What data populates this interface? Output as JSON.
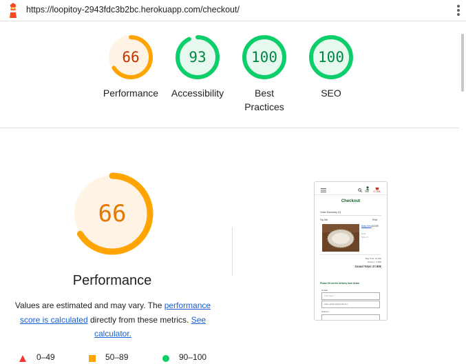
{
  "browser": {
    "url": "https://loopitoy-2943fdc3b2bc.herokuapp.com/checkout/"
  },
  "categories": [
    {
      "label": "Performance",
      "score": "66",
      "rating": "average"
    },
    {
      "label": "Accessibility",
      "score": "93",
      "rating": "pass"
    },
    {
      "label": "Best Practices",
      "label_lines": [
        "Best",
        "Practices"
      ],
      "score": "100",
      "rating": "pass"
    },
    {
      "label": "SEO",
      "score": "100",
      "rating": "pass"
    }
  ],
  "detail": {
    "score": "66",
    "title": "Performance",
    "desc_prefix": "Values are estimated and may vary. The ",
    "desc_link1": "performance score is calculated",
    "desc_middle": " directly from these metrics. ",
    "desc_link2": "See calculator."
  },
  "legend": [
    {
      "range": "0–49",
      "shape": "triangle",
      "color": "#ff3333"
    },
    {
      "range": "50–89",
      "shape": "square",
      "color": "#ffa400"
    },
    {
      "range": "90–100",
      "shape": "circle",
      "color": "#0cce6b"
    }
  ],
  "colors": {
    "average": "#ffa400",
    "average_text": "#c33300",
    "average_bg": "#fff3e6",
    "pass": "#0cce6b",
    "pass_text": "#018642",
    "pass_bg": "#e7f9ee",
    "link": "#1a5fd0"
  },
  "preview": {
    "header_icons": [
      "menu-icon",
      "search-icon",
      "user-icon",
      "basket-icon"
    ],
    "account_label": "Sell",
    "basket_total": "27.80€",
    "page_heading": "Checkout",
    "order_summary": "Order Summary (1)",
    "col_item": "Toy Info",
    "col_price": "Price",
    "item_name": "Baby Nest",
    "item_meta_1": "Gold",
    "item_meta_2": "Size: N",
    "item_price": "24.00€",
    "bag_total": "Bag Total: 24.00€",
    "delivery": "Delivery: 3.80€",
    "grand_total": "Grand Total: 27.80€",
    "form_prompt": "Please fill out the delivery form below",
    "details_label": "Details",
    "fullname_placeholder": "Full Name *",
    "email_value": "sales.gullions@gmail.com",
    "delivery_label": "Delivery"
  }
}
